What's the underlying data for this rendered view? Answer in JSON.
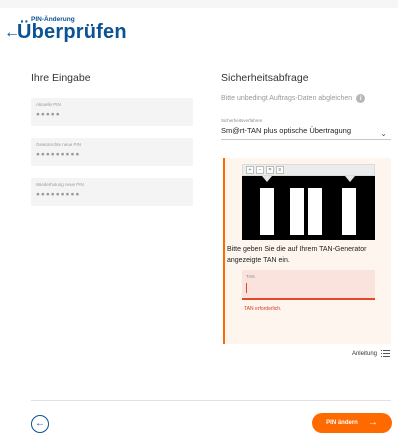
{
  "header": {
    "supertitle": "PIN-Änderung",
    "title": "Überprüfen",
    "back_glyph": "←"
  },
  "left": {
    "section_title": "Ihre Eingabe",
    "fields": [
      {
        "label": "Aktuelle PIN",
        "value": "●●●●●"
      },
      {
        "label": "Gewünschte neue PIN",
        "value": "●●●●●●●●●"
      },
      {
        "label": "Wiederholung neue PIN",
        "value": "●●●●●●●●●"
      }
    ]
  },
  "right": {
    "section_title": "Sicherheitsabfrage",
    "hint": "Bitte unbedingt Auftrags-Daten abgleichen",
    "info_icon": "i",
    "select": {
      "label": "Sicherheitsverfahren",
      "value": "Sm@rt-TAN plus optische Übertragung",
      "chevron": "⌄"
    },
    "tan": {
      "instruction": "Bitte geben Sie die auf Ihrem TAN-Generator angezeigte TAN ein.",
      "input_label": "TAN",
      "input_value": "",
      "error": "TAN erforderlich.",
      "toolbar": [
        "+",
        "−",
        "=",
        "≡"
      ]
    }
  },
  "anleitung": {
    "label": "Anleitung"
  },
  "footer": {
    "back_glyph": "←",
    "primary_label": "PIN ändern",
    "primary_arrow": "→"
  },
  "colors": {
    "brand_blue": "#0b5394",
    "accent_orange": "#ff6a00",
    "error_red": "#d23b1f"
  }
}
